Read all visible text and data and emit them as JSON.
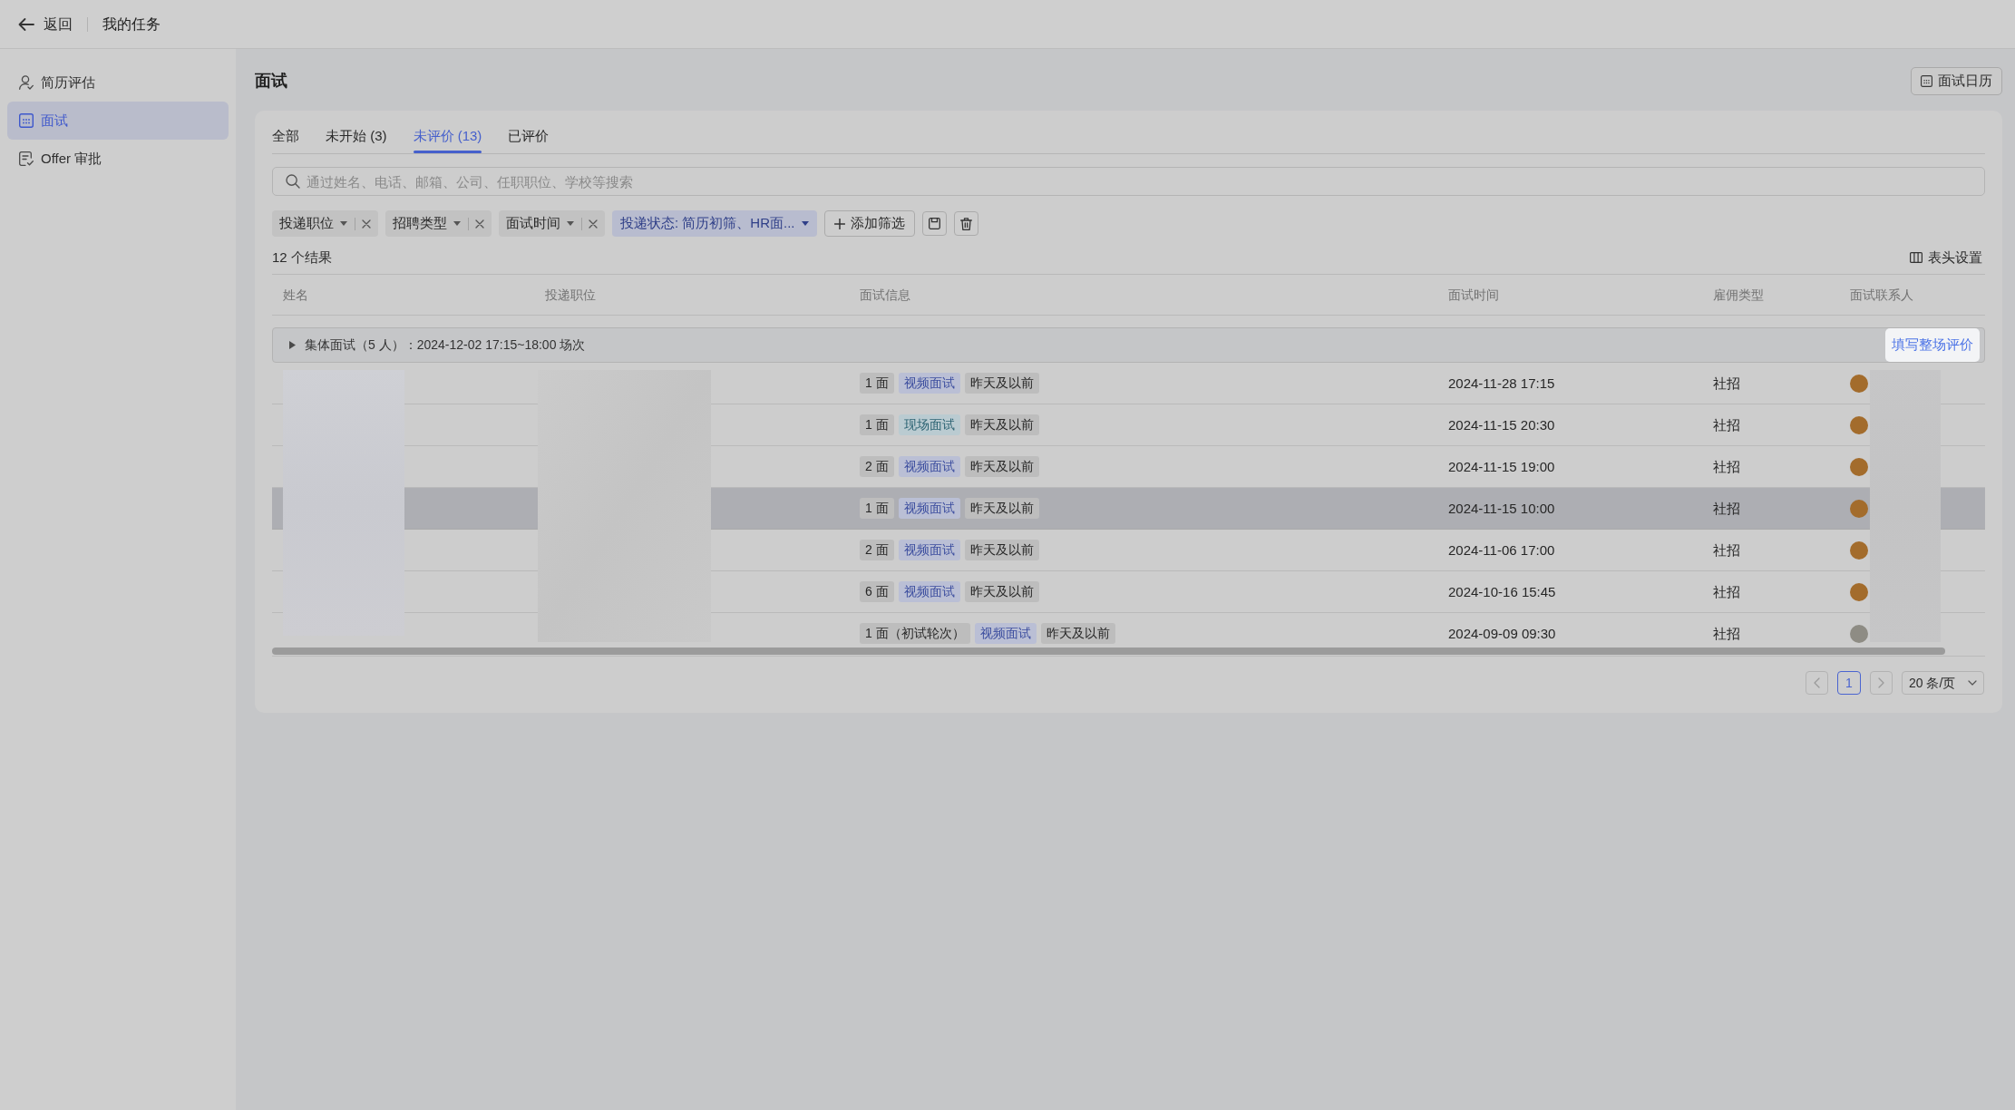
{
  "header": {
    "back_label": "返回",
    "title": "我的任务"
  },
  "sidebar": {
    "items": [
      {
        "label": "简历评估",
        "selected": false
      },
      {
        "label": "面试",
        "selected": true
      },
      {
        "label": "Offer 审批",
        "selected": false
      }
    ]
  },
  "page": {
    "title": "面试",
    "calendar_button": "面试日历"
  },
  "tabs": [
    {
      "label": "全部",
      "selected": false
    },
    {
      "label": "未开始 (3)",
      "selected": false
    },
    {
      "label": "未评价 (13)",
      "selected": true
    },
    {
      "label": "已评价",
      "selected": false
    }
  ],
  "search": {
    "placeholder": "通过姓名、电话、邮箱、公司、任职职位、学校等搜索"
  },
  "filters": [
    {
      "label": "投递职位",
      "active": false,
      "clearable": true
    },
    {
      "label": "招聘类型",
      "active": false,
      "clearable": true
    },
    {
      "label": "面试时间",
      "active": false,
      "clearable": true
    },
    {
      "label": "投递状态: 简历初筛、HR面...",
      "active": true,
      "clearable": false
    }
  ],
  "add_filter": "添加筛选",
  "result_count": "12 个结果",
  "column_settings": "表头设置",
  "table": {
    "columns": [
      "姓名",
      "投递职位",
      "面试信息",
      "面试时间",
      "雇佣类型",
      "面试联系人"
    ],
    "group": {
      "label": "集体面试（5 人）：2024-12-02 17:15~18:00 场次",
      "expanded": false,
      "action": "填写整场评价"
    },
    "rows": [
      {
        "tags": [
          {
            "kind": "round",
            "text": "1 面"
          },
          {
            "kind": "video",
            "text": "视频面试"
          },
          {
            "kind": "time",
            "text": "昨天及以前"
          }
        ],
        "time": "2024-11-28 17:15",
        "type": "社招",
        "highlighted": false,
        "contact": {
          "color": "#a36c2c"
        }
      },
      {
        "tags": [
          {
            "kind": "round",
            "text": "1 面"
          },
          {
            "kind": "onsite",
            "text": "现场面试"
          },
          {
            "kind": "time",
            "text": "昨天及以前"
          }
        ],
        "time": "2024-11-15 20:30",
        "type": "社招",
        "highlighted": false,
        "contact": {
          "color": "#a36c2c"
        }
      },
      {
        "tags": [
          {
            "kind": "round",
            "text": "2 面"
          },
          {
            "kind": "video",
            "text": "视频面试"
          },
          {
            "kind": "time",
            "text": "昨天及以前"
          }
        ],
        "time": "2024-11-15 19:00",
        "type": "社招",
        "highlighted": false,
        "contact": {
          "color": "#a36c2c"
        }
      },
      {
        "tags": [
          {
            "kind": "round",
            "text": "1 面"
          },
          {
            "kind": "video",
            "text": "视频面试"
          },
          {
            "kind": "time",
            "text": "昨天及以前"
          }
        ],
        "time": "2024-11-15 10:00",
        "type": "社招",
        "highlighted": true,
        "contact": {
          "color": "#a36c2c"
        }
      },
      {
        "tags": [
          {
            "kind": "round",
            "text": "2 面"
          },
          {
            "kind": "video",
            "text": "视频面试"
          },
          {
            "kind": "time",
            "text": "昨天及以前"
          }
        ],
        "time": "2024-11-06 17:00",
        "type": "社招",
        "highlighted": false,
        "contact": {
          "color": "#a36c2c"
        }
      },
      {
        "tags": [
          {
            "kind": "round",
            "text": "6 面"
          },
          {
            "kind": "video",
            "text": "视频面试"
          },
          {
            "kind": "time",
            "text": "昨天及以前"
          }
        ],
        "time": "2024-10-16 15:45",
        "type": "社招",
        "highlighted": false,
        "contact": {
          "color": "#a36c2c"
        }
      },
      {
        "tags": [
          {
            "kind": "round",
            "text": "1 面（初试轮次）"
          },
          {
            "kind": "video",
            "text": "视频面试"
          },
          {
            "kind": "time",
            "text": "昨天及以前"
          }
        ],
        "time": "2024-09-09 09:30",
        "type": "社招",
        "highlighted": false,
        "contact": {
          "color": "#8e8c84"
        }
      }
    ]
  },
  "pagination": {
    "prev_disabled": true,
    "pages": [
      {
        "label": "1",
        "selected": true
      }
    ],
    "next_disabled": true,
    "page_size": "20 条/页"
  }
}
